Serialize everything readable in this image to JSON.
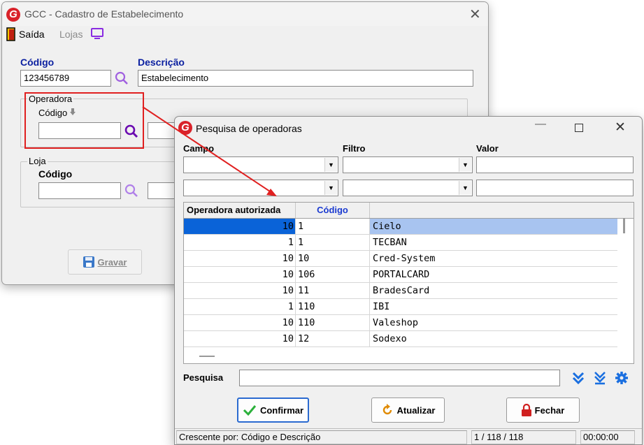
{
  "back_window": {
    "title": "GCC - Cadastro de Estabelecimento",
    "toolbar": {
      "exit_label": "Saída",
      "stores_label": "Lojas"
    },
    "codigo_label": "Código",
    "codigo_value": "123456789",
    "descricao_label": "Descrição",
    "descricao_value": "Estabelecimento",
    "operadora_group": {
      "legend": "Operadora",
      "codigo_label": "Código"
    },
    "loja_group": {
      "legend": "Loja",
      "codigo_label": "Código"
    },
    "save_label": "Gravar"
  },
  "front_window": {
    "title": "Pesquisa de operadoras",
    "filter_headers": {
      "campo": "Campo",
      "filtro": "Filtro",
      "valor": "Valor"
    },
    "grid": {
      "columns": [
        "Operadora autorizada",
        "Código",
        ""
      ],
      "rows": [
        {
          "autorizada": "10",
          "codigo": "1",
          "nome": "Cielo",
          "selected": true
        },
        {
          "autorizada": "1",
          "codigo": "1",
          "nome": "TECBAN"
        },
        {
          "autorizada": "10",
          "codigo": "10",
          "nome": "Cred-System"
        },
        {
          "autorizada": "10",
          "codigo": "106",
          "nome": "PORTALCARD"
        },
        {
          "autorizada": "10",
          "codigo": "11",
          "nome": "BradesCard"
        },
        {
          "autorizada": "1",
          "codigo": "110",
          "nome": "IBI"
        },
        {
          "autorizada": "10",
          "codigo": "110",
          "nome": "Valeshop"
        },
        {
          "autorizada": "10",
          "codigo": "12",
          "nome": "Sodexo"
        }
      ]
    },
    "search_label": "Pesquisa",
    "buttons": {
      "confirm": "Confirmar",
      "refresh": "Atualizar",
      "close": "Fechar"
    },
    "status": {
      "sort": "Crescente por: Código e Descrição",
      "count": "1 / 118 / 118",
      "time": "00:00:00"
    }
  },
  "colors": {
    "accent_blue": "#0a1fa0",
    "highlight_red": "#e02020",
    "selection": "#a8c4f0",
    "selection_strong": "#0a63d8",
    "icon_blue": "#1a6fe0"
  }
}
